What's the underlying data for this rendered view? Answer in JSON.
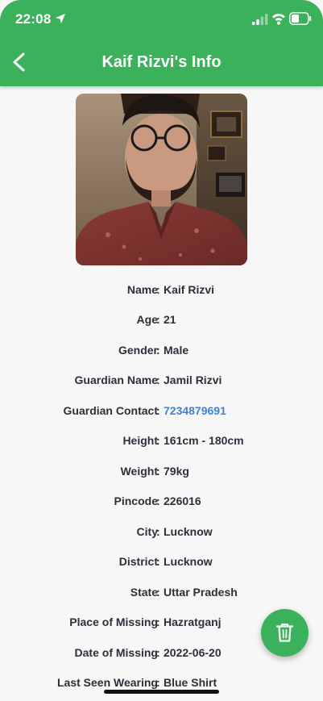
{
  "status_bar": {
    "time": "22:08"
  },
  "header": {
    "title": "Kaif Rizvi's Info",
    "back_icon": "chevron-left-icon"
  },
  "colors": {
    "accent": "#3cb15b",
    "link": "#3d82d6",
    "text": "#2e2f3a"
  },
  "fields": [
    {
      "label": "Name",
      "value": "Kaif Rizvi"
    },
    {
      "label": "Age",
      "value": "21"
    },
    {
      "label": "Gender",
      "value": "Male"
    },
    {
      "label": "Guardian Name",
      "value": "Jamil Rizvi"
    },
    {
      "label": "Guardian Contact",
      "value": "7234879691"
    },
    {
      "label": "Height",
      "value": "161cm - 180cm"
    },
    {
      "label": "Weight",
      "value": "79kg"
    },
    {
      "label": "Pincode",
      "value": "226016"
    },
    {
      "label": "City",
      "value": "Lucknow"
    },
    {
      "label": "District",
      "value": "Lucknow"
    },
    {
      "label": "State",
      "value": "Uttar Pradesh"
    },
    {
      "label": "Place of Missing",
      "value": "Hazratganj"
    },
    {
      "label": "Date of Missing",
      "value": "2022-06-20"
    },
    {
      "label": "Last Seen Wearing",
      "value": "Blue Shirt"
    }
  ],
  "separator": ":",
  "fab": {
    "icon": "trash-icon"
  }
}
